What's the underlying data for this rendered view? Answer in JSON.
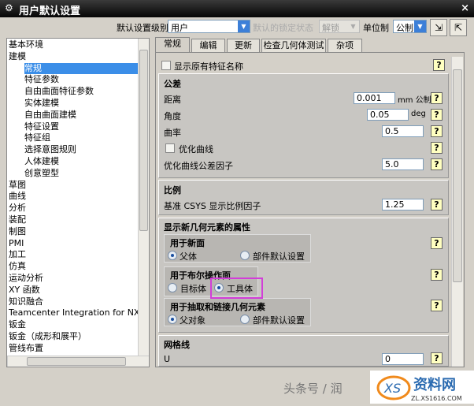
{
  "window": {
    "title": "用户默认设置",
    "close": "×",
    "gear": "⚙"
  },
  "toolbar": {
    "level_label": "默认设置级别",
    "level_value": "用户",
    "lock_label": "默认的锁定状态",
    "lock_value": "解锁",
    "unit_label": "单位制",
    "unit_value": "公制",
    "tool1_icon": "import-icon",
    "tool2_icon": "export-icon"
  },
  "tree": {
    "items": [
      {
        "label": "基本环境"
      },
      {
        "label": "建模"
      },
      {
        "label": "常规",
        "sub": true,
        "selected": true
      },
      {
        "label": "特征参数",
        "sub": true
      },
      {
        "label": "自由曲面特征参数",
        "sub": true
      },
      {
        "label": "实体建模",
        "sub": true
      },
      {
        "label": "自由曲面建模",
        "sub": true
      },
      {
        "label": "特征设置",
        "sub": true
      },
      {
        "label": "特征组",
        "sub": true
      },
      {
        "label": "选择意图规则",
        "sub": true
      },
      {
        "label": "人体建模",
        "sub": true
      },
      {
        "label": "创意塑型",
        "sub": true
      },
      {
        "label": "草图"
      },
      {
        "label": "曲线"
      },
      {
        "label": "分析"
      },
      {
        "label": "装配"
      },
      {
        "label": "制图"
      },
      {
        "label": "PMI"
      },
      {
        "label": "加工"
      },
      {
        "label": "仿真"
      },
      {
        "label": "运动分析"
      },
      {
        "label": "XY 函数"
      },
      {
        "label": "知识融合"
      },
      {
        "label": "Teamcenter Integration for NX"
      },
      {
        "label": "钣金"
      },
      {
        "label": "钣金（成形和展平）"
      },
      {
        "label": "管线布置"
      }
    ]
  },
  "tabs": [
    "常规",
    "编辑",
    "更新",
    "检查几何体测试",
    "杂项"
  ],
  "main": {
    "show_original_names": "显示原有特征名称",
    "tolerance": {
      "title": "公差",
      "distance_label": "距离",
      "distance": "0.001",
      "distance_unit": "mm 公制",
      "angle_label": "角度",
      "angle": "0.05",
      "angle_unit": "deg",
      "curvature_label": "曲率",
      "curvature": "0.5",
      "optimize_label": "优化曲线",
      "factor_label": "优化曲线公差因子",
      "factor": "5.0"
    },
    "scale": {
      "title": "比例",
      "csys_label": "基准 CSYS 显示比例因子",
      "csys": "1.25"
    },
    "new_geom": {
      "title": "显示新几何元素的属性",
      "new_face": {
        "title": "用于新面",
        "opt1": "父体",
        "opt2": "部件默认设置",
        "selected": "父体"
      },
      "boolean": {
        "title": "用于布尔操作面",
        "opt1": "目标体",
        "opt2": "工具体",
        "selected": "工具体"
      },
      "extract": {
        "title": "用于抽取和链接几何元素",
        "opt1": "父对象",
        "opt2": "部件默认设置",
        "selected": "父对象"
      }
    },
    "grid": {
      "title": "网格线",
      "u_label": "U",
      "u": "0"
    },
    "help": "?"
  },
  "watermark": {
    "text": "头条号 / 润",
    "logo": "资料网 ZL.XS1616.COM"
  },
  "colors": {
    "selection": "#3b8ee8",
    "highlight": "#d23ed8"
  }
}
